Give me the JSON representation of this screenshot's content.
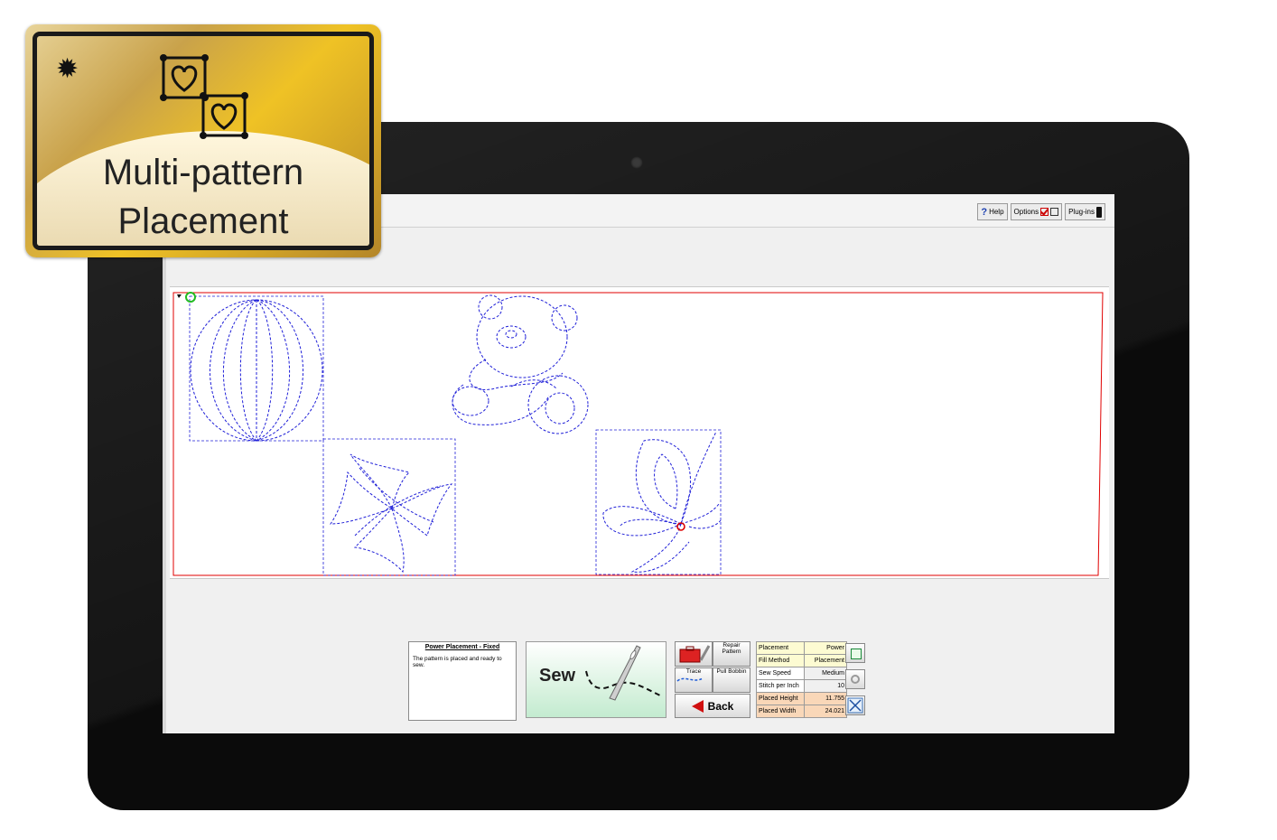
{
  "badge": {
    "line1": "Multi-pattern",
    "line2": "Placement",
    "star_icon": "starburst-icon",
    "pattern_icon": "multi-heart-placement-icon"
  },
  "toolbar": {
    "help_label": "Help",
    "options_label": "Options",
    "plugins_label": "Plug-ins"
  },
  "canvas": {
    "patterns": [
      "pumpkin-pattern",
      "teddy-bear-pattern",
      "star-swirl-pattern",
      "butterfly-pattern"
    ],
    "start_marker_color": "#22bb22",
    "end_marker_color": "#dd0000",
    "boundary_color": "#e00000",
    "stitch_color": "#2020d8"
  },
  "message": {
    "title": "Power Placement - Fixed",
    "body": "The pattern is placed and ready to sew."
  },
  "sew_button": {
    "label": "Sew"
  },
  "tools": {
    "repair_label": "Repair Pattern",
    "trace_label": "Trace",
    "pull_bobbin_label": "Pull Bobbin",
    "back_label": "Back"
  },
  "settings": [
    {
      "key": "Placement",
      "value": "Power"
    },
    {
      "key": "Fill Method",
      "value": "Placement"
    },
    {
      "key": "Sew Speed",
      "value": "Medium"
    },
    {
      "key": "Stitch per Inch",
      "value": "10"
    },
    {
      "key": "Placed Height",
      "value": "11.755"
    },
    {
      "key": "Placed Width",
      "value": "24.021"
    }
  ]
}
